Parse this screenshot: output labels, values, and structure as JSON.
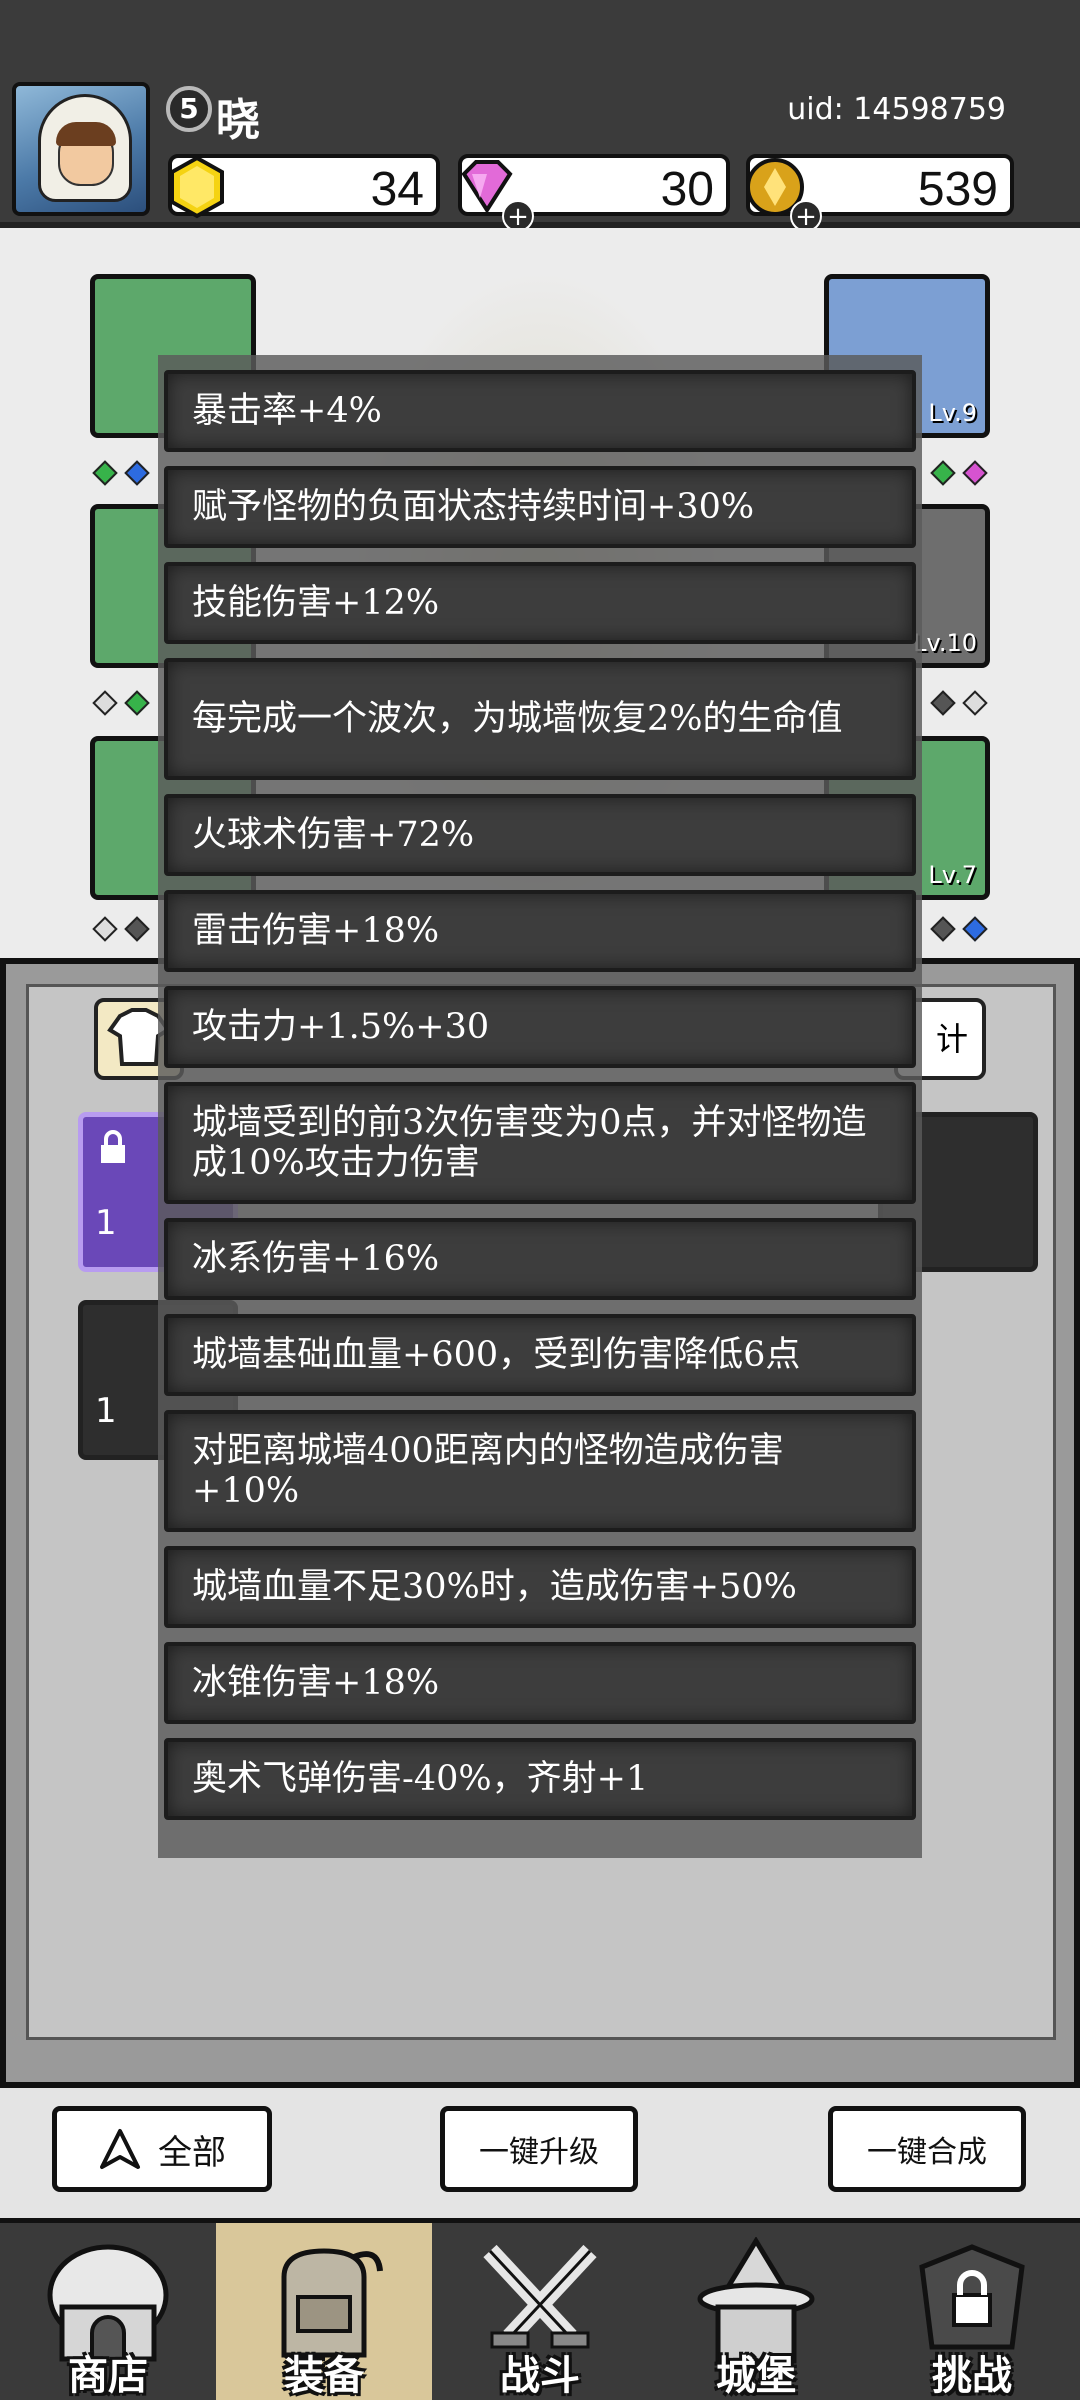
{
  "player": {
    "name": "晓",
    "level": "5",
    "uid": "uid: 14598759"
  },
  "resources": [
    {
      "name": "gold-gem",
      "value": "34",
      "color": "#f5d312"
    },
    {
      "name": "diamond",
      "value": "30",
      "color": "#e26ad8"
    },
    {
      "name": "coin",
      "value": "539",
      "color": "#d9a21a"
    }
  ],
  "equipment": {
    "levels": [
      "Lv.9",
      "Lv.10",
      "Lv.7"
    ]
  },
  "panel": {
    "stats_button_label": "计",
    "item_counts": [
      "1",
      "1"
    ]
  },
  "stats_popup": [
    "暴击率+4%",
    "赋予怪物的负面状态持续时间+30%",
    "技能伤害+12%",
    "每完成一个波次，为城墙恢复2%的生命值",
    "火球术伤害+72%",
    "雷击伤害+18%",
    "攻击力+1.5%+30",
    "城墙受到的前3次伤害变为0点，并对怪物造成10%攻击力伤害",
    "冰系伤害+16%",
    "城墙基础血量+600，受到伤害降低6点",
    "对距离城墙400距离内的怪物造成伤害+10%",
    "城墙血量不足30%时，造成伤害+50%",
    "冰锥伤害+18%",
    "奥术飞弹伤害-40%，齐射+1"
  ],
  "actions": {
    "filter_label": "全部",
    "upgrade_all_label": "一键升级",
    "merge_all_label": "一键合成"
  },
  "nav": [
    {
      "label": "商店",
      "icon": "shop-icon"
    },
    {
      "label": "装备",
      "icon": "backpack-icon"
    },
    {
      "label": "战斗",
      "icon": "crossed-swords-icon"
    },
    {
      "label": "城堡",
      "icon": "castle-icon"
    },
    {
      "label": "挑战",
      "icon": "locked-helmet-icon"
    }
  ]
}
